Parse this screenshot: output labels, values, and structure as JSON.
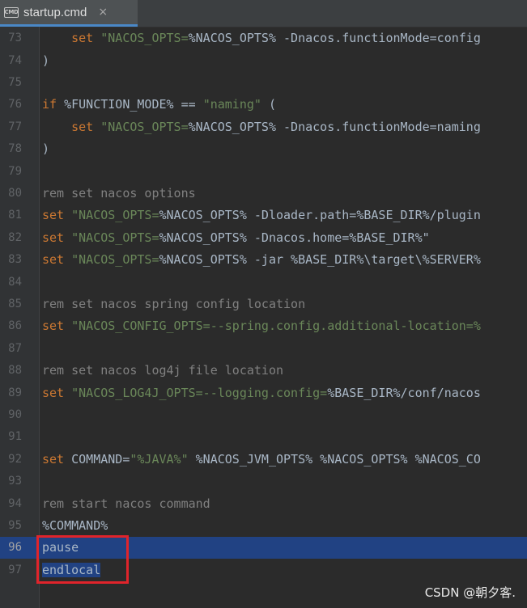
{
  "tab": {
    "icon": "cmd-file-icon",
    "icon_text": "CMD",
    "title": "startup.cmd",
    "close": "×"
  },
  "lines": [
    {
      "n": "73",
      "tokens": [
        {
          "t": "    "
        },
        {
          "t": "set ",
          "c": "kw"
        },
        {
          "t": "\"NACOS_OPTS=",
          "c": "str"
        },
        {
          "t": "%NACOS_OPTS% "
        },
        {
          "t": "-Dnacos.functionMode=config"
        }
      ]
    },
    {
      "n": "74",
      "tokens": [
        {
          "t": ")"
        }
      ]
    },
    {
      "n": "75",
      "tokens": []
    },
    {
      "n": "76",
      "tokens": [
        {
          "t": "if ",
          "c": "kw"
        },
        {
          "t": "%FUNCTION_MODE% == "
        },
        {
          "t": "\"naming\"",
          "c": "str"
        },
        {
          "t": " ("
        }
      ]
    },
    {
      "n": "77",
      "tokens": [
        {
          "t": "    "
        },
        {
          "t": "set ",
          "c": "kw"
        },
        {
          "t": "\"NACOS_OPTS=",
          "c": "str"
        },
        {
          "t": "%NACOS_OPTS% "
        },
        {
          "t": "-Dnacos.functionMode=naming"
        }
      ]
    },
    {
      "n": "78",
      "tokens": [
        {
          "t": ")"
        }
      ]
    },
    {
      "n": "79",
      "tokens": []
    },
    {
      "n": "80",
      "tokens": [
        {
          "t": "rem set nacos options",
          "c": "cm"
        }
      ]
    },
    {
      "n": "81",
      "tokens": [
        {
          "t": "set ",
          "c": "kw"
        },
        {
          "t": "\"NACOS_OPTS=",
          "c": "str"
        },
        {
          "t": "%NACOS_OPTS% "
        },
        {
          "t": "-Dloader.path=%BASE_DIR%/plugin"
        }
      ]
    },
    {
      "n": "82",
      "tokens": [
        {
          "t": "set ",
          "c": "kw"
        },
        {
          "t": "\"NACOS_OPTS=",
          "c": "str"
        },
        {
          "t": "%NACOS_OPTS% "
        },
        {
          "t": "-Dnacos.home=%BASE_DIR%\""
        }
      ]
    },
    {
      "n": "83",
      "tokens": [
        {
          "t": "set ",
          "c": "kw"
        },
        {
          "t": "\"NACOS_OPTS=",
          "c": "str"
        },
        {
          "t": "%NACOS_OPTS% "
        },
        {
          "t": "-jar %BASE_DIR%\\target\\%SERVER%"
        }
      ]
    },
    {
      "n": "84",
      "tokens": []
    },
    {
      "n": "85",
      "tokens": [
        {
          "t": "rem set nacos spring config location",
          "c": "cm"
        }
      ]
    },
    {
      "n": "86",
      "tokens": [
        {
          "t": "set ",
          "c": "kw"
        },
        {
          "t": "\"NACOS_CONFIG_OPTS=--spring.config.additional-location=%",
          "c": "str"
        }
      ]
    },
    {
      "n": "87",
      "tokens": []
    },
    {
      "n": "88",
      "tokens": [
        {
          "t": "rem set nacos log4j file location",
          "c": "cm"
        }
      ]
    },
    {
      "n": "89",
      "tokens": [
        {
          "t": "set ",
          "c": "kw"
        },
        {
          "t": "\"NACOS_LOG4J_OPTS=--logging.config=",
          "c": "str"
        },
        {
          "t": "%BASE_DIR%/conf/nacos"
        }
      ]
    },
    {
      "n": "90",
      "tokens": []
    },
    {
      "n": "91",
      "tokens": []
    },
    {
      "n": "92",
      "tokens": [
        {
          "t": "set ",
          "c": "kw"
        },
        {
          "t": "COMMAND="
        },
        {
          "t": "\"%JAVA%\"",
          "c": "str"
        },
        {
          "t": " %NACOS_JVM_OPTS% %NACOS_OPTS% %NACOS_CO"
        }
      ]
    },
    {
      "n": "93",
      "tokens": []
    },
    {
      "n": "94",
      "tokens": [
        {
          "t": "rem start nacos command",
          "c": "cm"
        }
      ]
    },
    {
      "n": "95",
      "tokens": [
        {
          "t": "%COMMAND%"
        }
      ]
    },
    {
      "n": "96",
      "current": true,
      "tokens": [
        {
          "t": "pause",
          "c": "sel"
        }
      ]
    },
    {
      "n": "97",
      "tokens": [
        {
          "t": "endlocal",
          "c": "sel"
        }
      ]
    }
  ],
  "watermark": "CSDN @朝夕客."
}
